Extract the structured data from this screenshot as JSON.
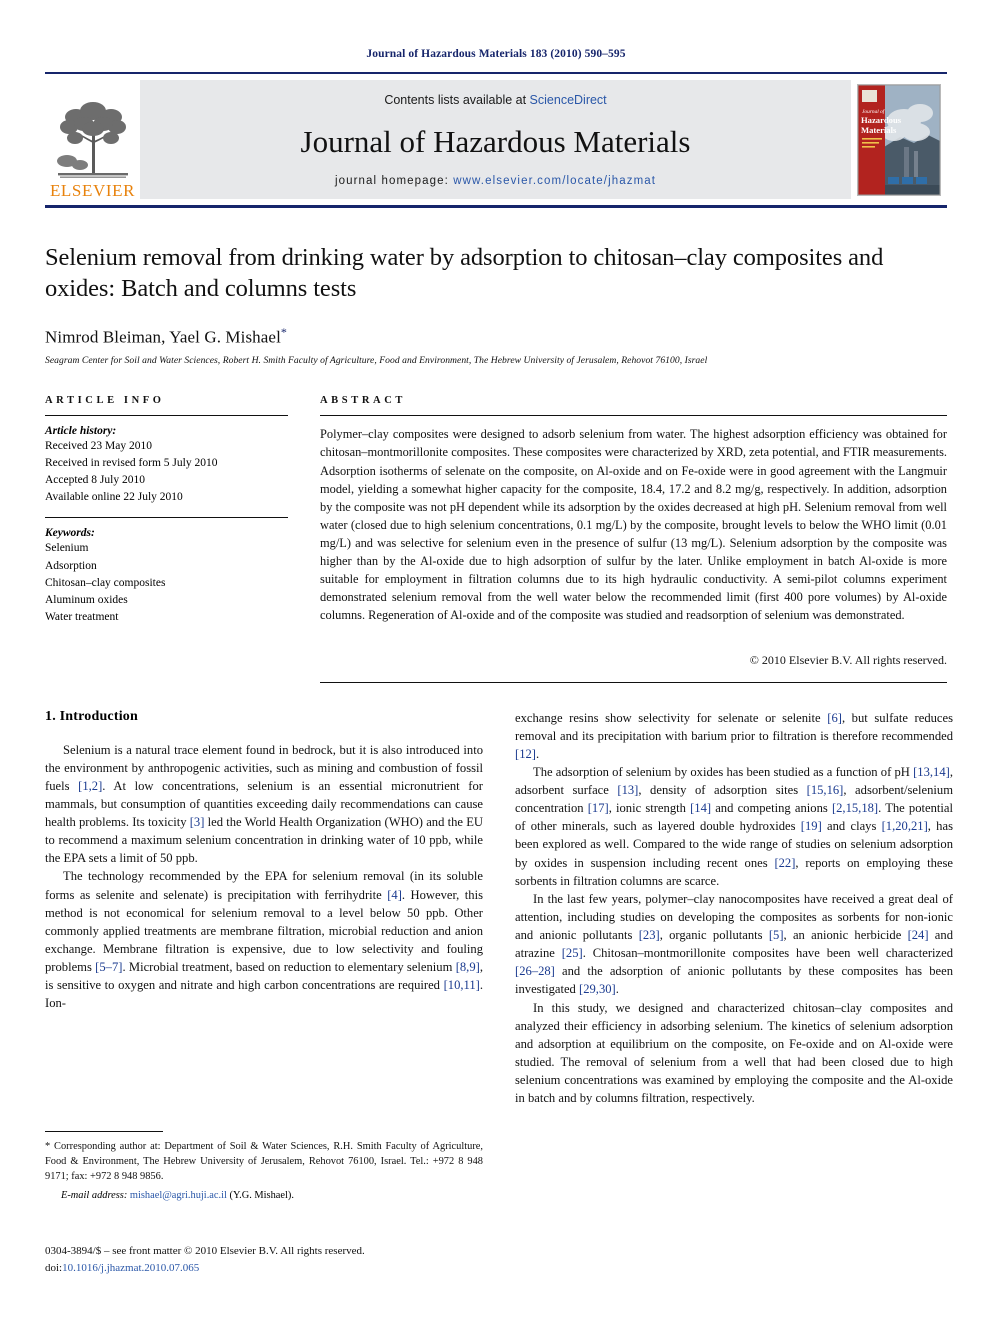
{
  "running_head": "Journal of Hazardous Materials 183 (2010) 590–595",
  "masthead": {
    "contents_prefix": "Contents lists available at ",
    "sciencedirect": "ScienceDirect",
    "journal_name": "Journal of Hazardous Materials",
    "homepage_prefix": "journal homepage:",
    "homepage_url": "www.elsevier.com/locate/jhazmat",
    "publisher_wordmark": "ELSEVIER",
    "cover_title_line1": "Journal of",
    "cover_title_line2": "Hazardous",
    "cover_title_line3": "Materials",
    "accent_blue": "#16256b",
    "accent_orange": "#e8820c",
    "band_gray": "#e7e8ea",
    "link_blue": "#2a57a8"
  },
  "title_block": {
    "title": "Selenium removal from drinking water by adsorption to chitosan–clay composites and oxides: Batch and columns tests",
    "authors": "Nimrod Bleiman, Yael G. Mishael",
    "corresponding_marker": "*",
    "affiliation": "Seagram Center for Soil and Water Sciences, Robert H. Smith Faculty of Agriculture, Food and Environment, The Hebrew University of Jerusalem, Rehovot 76100, Israel"
  },
  "article_info": {
    "heading": "ARTICLE INFO",
    "history_label": "Article history:",
    "history": [
      "Received 23 May 2010",
      "Received in revised form 5 July 2010",
      "Accepted 8 July 2010",
      "Available online 22 July 2010"
    ],
    "keywords_label": "Keywords:",
    "keywords": [
      "Selenium",
      "Adsorption",
      "Chitosan–clay composites",
      "Aluminum oxides",
      "Water treatment"
    ]
  },
  "abstract": {
    "heading": "ABSTRACT",
    "text": "Polymer–clay composites were designed to adsorb selenium from water. The highest adsorption efficiency was obtained for chitosan–montmorillonite composites. These composites were characterized by XRD, zeta potential, and FTIR measurements. Adsorption isotherms of selenate on the composite, on Al-oxide and on Fe-oxide were in good agreement with the Langmuir model, yielding a somewhat higher capacity for the composite, 18.4, 17.2 and 8.2 mg/g, respectively. In addition, adsorption by the composite was not pH dependent while its adsorption by the oxides decreased at high pH. Selenium removal from well water (closed due to high selenium concentrations, 0.1 mg/L) by the composite, brought levels to below the WHO limit (0.01 mg/L) and was selective for selenium even in the presence of sulfur (13 mg/L). Selenium adsorption by the composite was higher than by the Al-oxide due to high adsorption of sulfur by the later. Unlike employment in batch Al-oxide is more suitable for employment in filtration columns due to its high hydraulic conductivity. A semi-pilot columns experiment demonstrated selenium removal from the well water below the recommended limit (first 400 pore volumes) by Al-oxide columns. Regeneration of Al-oxide and of the composite was studied and readsorption of selenium was demonstrated.",
    "copyright": "© 2010 Elsevier B.V. All rights reserved."
  },
  "body": {
    "section_title": "1. Introduction",
    "left_paragraphs": [
      "Selenium is a natural trace element found in bedrock, but it is also introduced into the environment by anthropogenic activities, such as mining and combustion of fossil fuels [1,2]. At low concentrations, selenium is an essential micronutrient for mammals, but consumption of quantities exceeding daily recommendations can cause health problems. Its toxicity [3] led the World Health Organization (WHO) and the EU to recommend a maximum selenium concentration in drinking water of 10 ppb, while the EPA sets a limit of 50 ppb.",
      "The technology recommended by the EPA for selenium removal (in its soluble forms as selenite and selenate) is precipitation with ferrihydrite [4]. However, this method is not economical for selenium removal to a level below 50 ppb. Other commonly applied treatments are membrane filtration, microbial reduction and anion exchange. Membrane filtration is expensive, due to low selectivity and fouling problems [5–7]. Microbial treatment, based on reduction to elementary selenium [8,9], is sensitive to oxygen and nitrate and high carbon concentrations are required [10,11]. Ion-"
    ],
    "right_paragraphs": [
      "exchange resins show selectivity for selenate or selenite [6], but sulfate reduces removal and its precipitation with barium prior to filtration is therefore recommended [12].",
      "The adsorption of selenium by oxides has been studied as a function of pH [13,14], adsorbent surface [13], density of adsorption sites [15,16], adsorbent/selenium concentration [17], ionic strength [14] and competing anions [2,15,18]. The potential of other minerals, such as layered double hydroxides [19] and clays [1,20,21], has been explored as well. Compared to the wide range of studies on selenium adsorption by oxides in suspension including recent ones [22], reports on employing these sorbents in filtration columns are scarce.",
      "In the last few years, polymer–clay nanocomposites have received a great deal of attention, including studies on developing the composites as sorbents for non-ionic and anionic pollutants [23], organic pollutants [5], an anionic herbicide [24] and atrazine [25]. Chitosan–montmorillonite composites have been well characterized [26–28] and the adsorption of anionic pollutants by these composites has been investigated [29,30].",
      "In this study, we designed and characterized chitosan–clay composites and analyzed their efficiency in adsorbing selenium. The kinetics of selenium adsorption and adsorption at equilibrium on the composite, on Fe-oxide and on Al-oxide were studied. The removal of selenium from a well that had been closed due to high selenium concentrations was examined by employing the composite and the Al-oxide in batch and by columns filtration, respectively."
    ]
  },
  "footnotes": {
    "corresponding": "* Corresponding author at: Department of Soil & Water Sciences, R.H. Smith Faculty of Agriculture, Food & Environment, The Hebrew University of Jerusalem, Rehovot 76100, Israel. Tel.: +972 8 948 9171; fax: +972 8 948 9856.",
    "email_label": "E-mail address:",
    "email": "mishael@agri.huji.ac.il",
    "email_suffix": "(Y.G. Mishael)."
  },
  "imprint": {
    "line1": "0304-3894/$ – see front matter © 2010 Elsevier B.V. All rights reserved.",
    "doi_label": "doi:",
    "doi": "10.1016/j.jhazmat.2010.07.065"
  }
}
